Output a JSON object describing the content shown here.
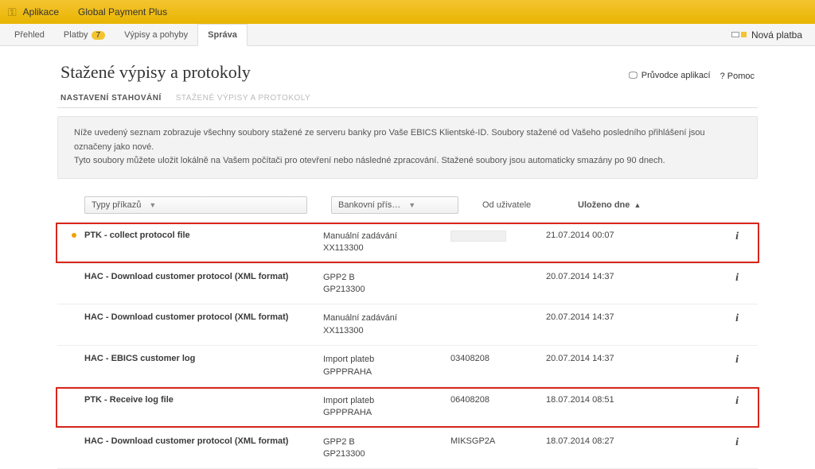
{
  "topbar": {
    "app1": "Aplikace",
    "app2": "Global Payment Plus"
  },
  "tabs": {
    "prehled": "Přehled",
    "platby": "Platby",
    "platby_badge": "7",
    "vypisy": "Výpisy a pohyby",
    "sprava": "Správa",
    "nova_platba": "Nová platba"
  },
  "page": {
    "title": "Stažené výpisy a protokoly",
    "wizard": "Průvodce aplikací",
    "help": "? Pomoc"
  },
  "subtabs": {
    "nastaveni": "NASTAVENÍ STAHOVÁNÍ",
    "stazene": "STAŽENÉ VÝPISY A PROTOKOLY"
  },
  "info": {
    "l1": "Níže uvedený seznam zobrazuje všechny soubory stažené ze serveru banky pro Vaše EBICS Klientské-ID. Soubory stažené od Vašeho posledního přihlášení jsou označeny jako nové.",
    "l2": "Tyto soubory můžete uložit lokálně na Vašem počítači pro otevření nebo následné zpracování. Stažené soubory jsou automaticky smazány po 90 dnech."
  },
  "filters": {
    "typy": "Typy příkazů",
    "banka": "Bankovní přís…",
    "od": "Od uživatele",
    "ulozeno": "Uloženo dne",
    "sort": "▲"
  },
  "rows": [
    {
      "dot": "orange",
      "name": "PTK - collect protocol file",
      "src1": "Manuální zadávání",
      "src2": "XX113300",
      "user": "",
      "user_placeholder": true,
      "date": "21.07.2014 00:07",
      "hl": true
    },
    {
      "dot": "none",
      "name": "HAC - Download customer protocol (XML format)",
      "src1": "GPP2 B",
      "src2": "GP213300",
      "user": "",
      "date": "20.07.2014 14:37"
    },
    {
      "dot": "none",
      "name": "HAC - Download customer protocol (XML format)",
      "src1": "Manuální zadávání",
      "src2": "XX113300",
      "user": "",
      "date": "20.07.2014 14:37"
    },
    {
      "dot": "none",
      "name": "HAC - EBICS customer log",
      "src1": "Import plateb",
      "src2": "GPPPRAHA",
      "user": "03408208",
      "date": "20.07.2014 14:37"
    },
    {
      "dot": "none",
      "name": "PTK - Receive log file",
      "src1": "Import plateb",
      "src2": "GPPPRAHA",
      "user": "06408208",
      "date": "18.07.2014 08:51",
      "hl": true
    },
    {
      "dot": "none",
      "name": "HAC - Download customer protocol (XML format)",
      "src1": "GPP2 B",
      "src2": "GP213300",
      "user": "MIKSGP2A",
      "date": "18.07.2014 08:27"
    }
  ],
  "icons": {
    "info": "i"
  }
}
